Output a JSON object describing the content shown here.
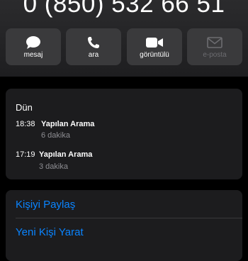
{
  "contact": {
    "phone_number": "0 (850) 532 66 51"
  },
  "actions": [
    {
      "label": "mesaj",
      "icon": "message-bubble-icon",
      "enabled": true
    },
    {
      "label": "ara",
      "icon": "phone-icon",
      "enabled": true
    },
    {
      "label": "görüntülü",
      "icon": "video-camera-icon",
      "enabled": true
    },
    {
      "label": "e-posta",
      "icon": "envelope-icon",
      "enabled": false
    }
  ],
  "call_history": {
    "day": "Dün",
    "entries": [
      {
        "time": "18:38",
        "type": "Yapılan Arama",
        "duration": "6 dakika"
      },
      {
        "time": "17:19",
        "type": "Yapılan Arama",
        "duration": "3 dakika"
      }
    ]
  },
  "links": {
    "share_contact": "Kişiyi Paylaş",
    "new_contact": "Yeni Kişi Yarat"
  },
  "colors": {
    "accent": "#0a84ff",
    "background": "#000000",
    "card": "#1c1c1e",
    "button": "#3a3a3c",
    "secondary_text": "#8e8e93"
  }
}
